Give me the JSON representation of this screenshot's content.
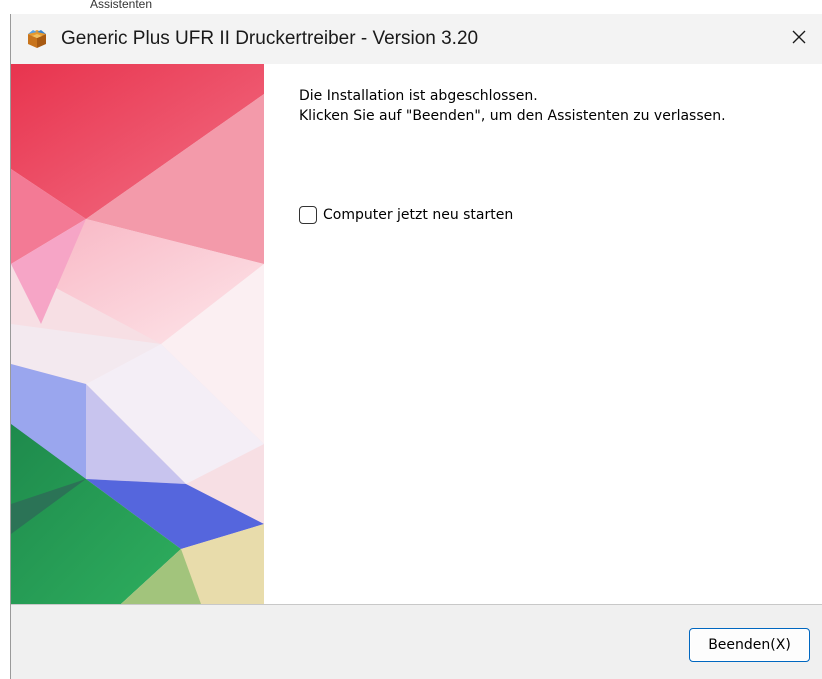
{
  "background": {
    "partial_text": "Assistenten"
  },
  "window": {
    "title": "Generic Plus UFR II Druckertreiber - Version 3.20",
    "app_icon": "package-box-icon",
    "close_icon": "close-icon"
  },
  "content": {
    "line1": "Die Installation ist abgeschlossen.",
    "line2": "Klicken Sie auf \"Beenden\", um den Assistenten zu verlassen.",
    "restart_checkbox": {
      "label": "Computer jetzt neu starten",
      "checked": false
    }
  },
  "footer": {
    "finish_button": "Beenden(X)"
  },
  "colors": {
    "accent": "#0067c0",
    "titlebar": "#f3f3f3",
    "footer": "#f0f0f0"
  }
}
